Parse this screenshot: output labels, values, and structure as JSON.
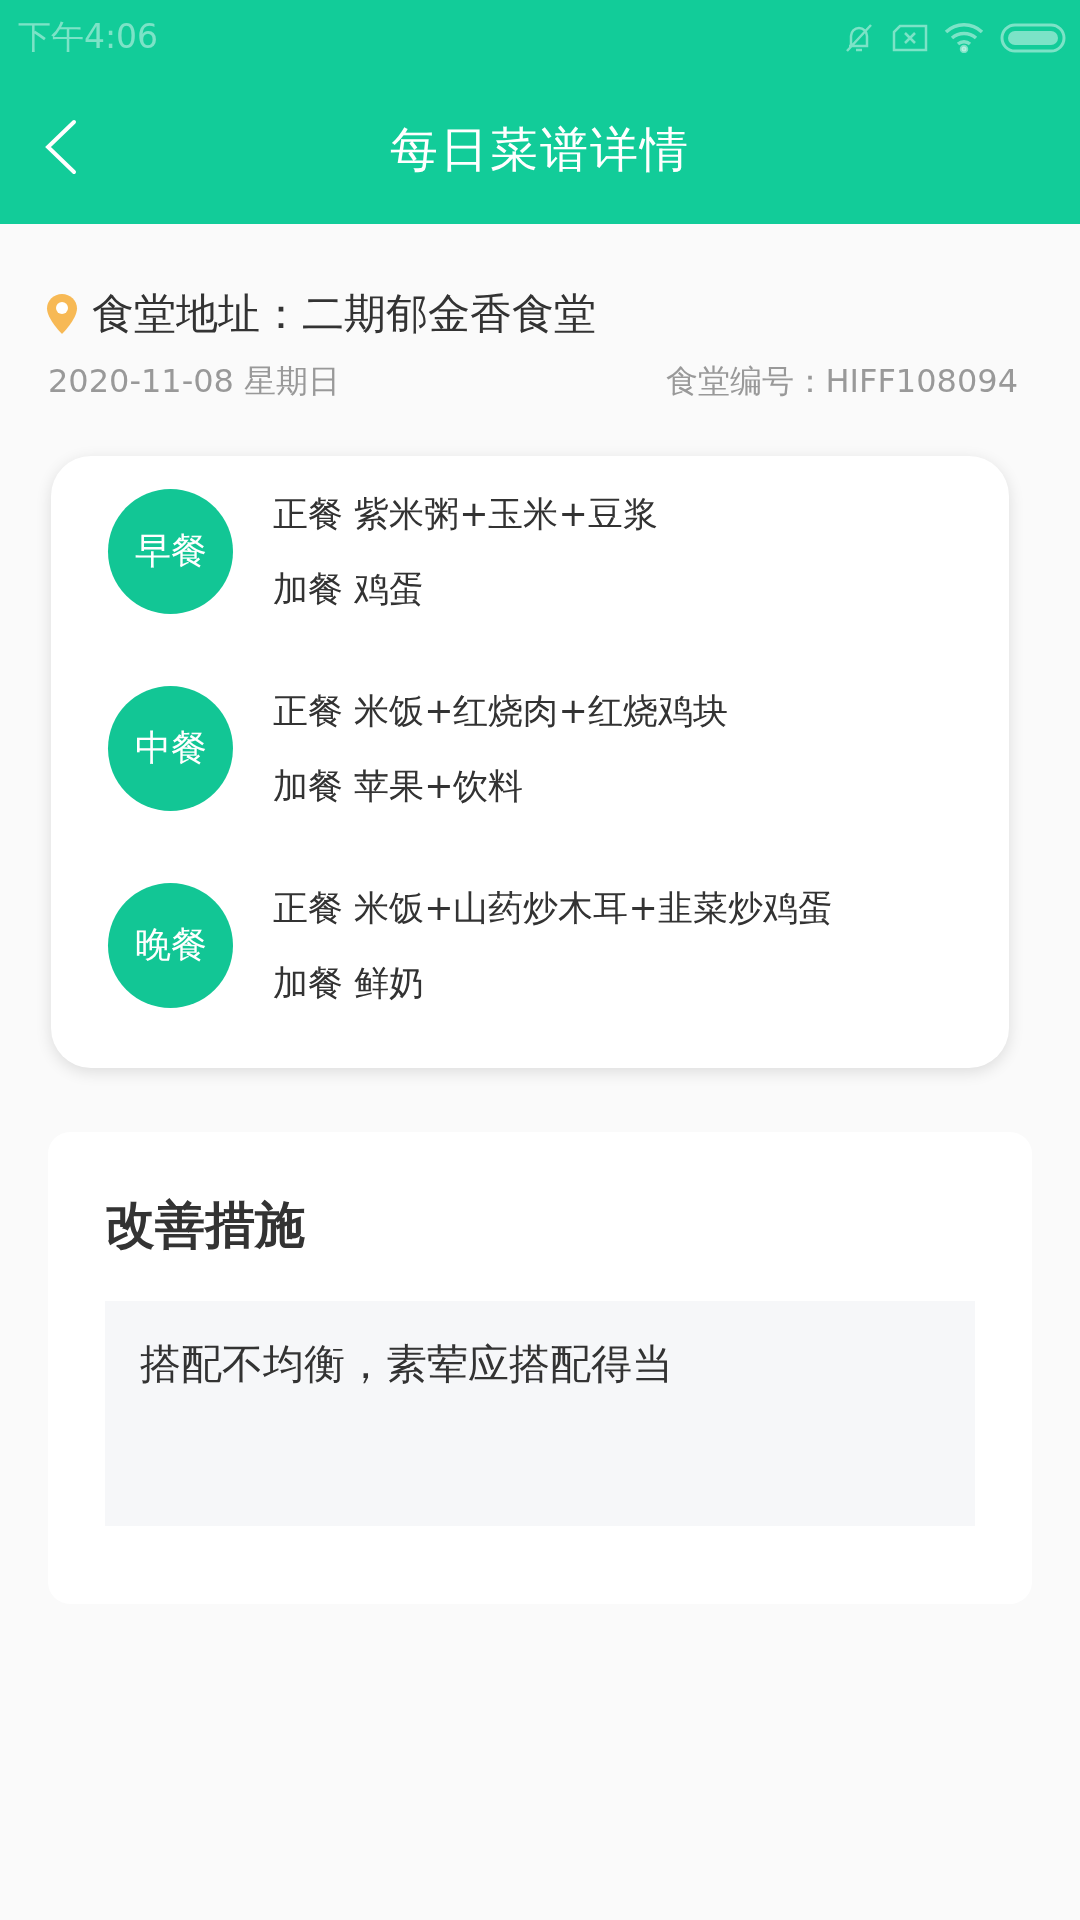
{
  "status_bar": {
    "time": "下午4:06"
  },
  "header": {
    "title": "每日菜谱详情"
  },
  "canteen": {
    "address": "食堂地址：二期郁金香食堂",
    "date": "2020-11-08 星期日",
    "code": "食堂编号：HIFF108094"
  },
  "meals": [
    {
      "name": "早餐",
      "lines": [
        {
          "label": "正餐",
          "text": "紫米粥+玉米+豆浆"
        },
        {
          "label": "加餐",
          "text": "鸡蛋"
        }
      ]
    },
    {
      "name": "中餐",
      "lines": [
        {
          "label": "正餐",
          "text": "米饭+红烧肉+红烧鸡块"
        },
        {
          "label": "加餐",
          "text": "苹果+饮料"
        }
      ]
    },
    {
      "name": "晚餐",
      "lines": [
        {
          "label": "正餐",
          "text": "米饭+山药炒木耳+韭菜炒鸡蛋"
        },
        {
          "label": "加餐",
          "text": "鲜奶"
        }
      ]
    }
  ],
  "improvement": {
    "title": "改善措施",
    "text": "搭配不均衡，素荤应搭配得当"
  }
}
